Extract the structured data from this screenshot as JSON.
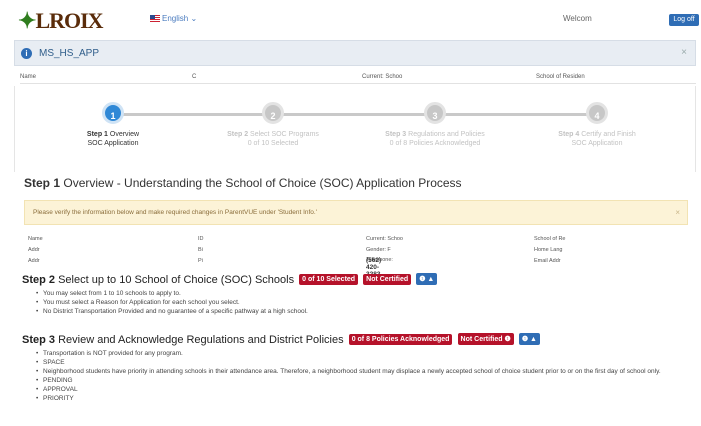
{
  "header": {
    "logo": "LROIX",
    "language": "English",
    "welcome": "Welcom",
    "logoff": "Log off"
  },
  "app": {
    "title": "MS_HS_APP",
    "close": "×"
  },
  "name_row": {
    "name": "Name",
    "c": "C",
    "current_school": "Current: Schoo",
    "school_of_residence": "School of Residen"
  },
  "wizard": {
    "steps": [
      {
        "num": "1",
        "title_bold": "Step 1",
        "title": "Overview",
        "sub": "SOC Application"
      },
      {
        "num": "2",
        "title_bold": "Step 2",
        "title": "Select SOC Programs",
        "sub": "0 of 10 Selected"
      },
      {
        "num": "3",
        "title_bold": "Step 3",
        "title": "Regulations and Policies",
        "sub": "0 of 8 Policies Acknowledged"
      },
      {
        "num": "4",
        "title_bold": "Step 4",
        "title": "Certify and Finish",
        "sub": "SOC Application"
      }
    ]
  },
  "step1": {
    "bold": "Step 1",
    "title": "Overview - Understanding the School of Choice (SOC) Application Process"
  },
  "alert": {
    "message": "Please verify the information below and make required changes in ParentVUE under 'Student Info.'",
    "close": "×"
  },
  "info": {
    "name": "Name",
    "addr1": "Addr",
    "addr2": "Addr",
    "id": "ID",
    "bi": "Bi",
    "pi": "Pi",
    "current_school": "Current: Schoo",
    "gender": "Gender: F",
    "telephone_label": "Telephone:",
    "telephone": "(562) 420-3283",
    "school_of_re": "School of Re",
    "home_lang": "Home Lang",
    "email": "Email Addr"
  },
  "step2": {
    "bold": "Step 2",
    "title": "Select up to 10 School of Choice (SOC) Schools",
    "badge_selected": "0 of 10 Selected",
    "badge_cert": "Not Certified",
    "info_btn": "❶ ▲",
    "bullets": [
      "You may select from 1 to 10 schools to apply to.",
      "You must select a Reason for Application for each school you select.",
      "No District Transportation Provided and no guarantee of a specific pathway at a high school."
    ]
  },
  "step3": {
    "bold": "Step 3",
    "title": "Review and Acknowledge Regulations and District Policies",
    "badge_ack": "0 of 8 Policies Acknowledged",
    "badge_cert": "Not Certified ❶",
    "info_btn": "❶ ▲",
    "bullets": [
      "Transportation is NOT provided for any program.",
      "SPACE",
      "Neighborhood students have priority in attending schools in their attendance area. Therefore, a neighborhood student may displace a newly accepted school of choice student prior to or on the first day of school only.",
      "PENDING",
      "APPROVAL",
      "PRIORITY"
    ]
  }
}
